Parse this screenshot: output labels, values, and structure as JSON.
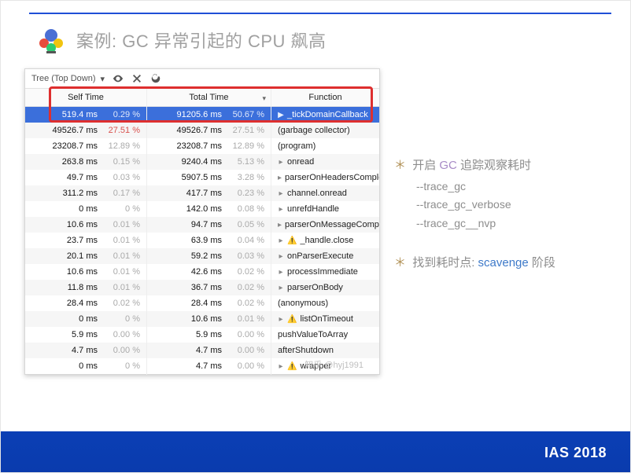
{
  "header": {
    "title": "案例: GC 异常引起的 CPU 飙高"
  },
  "panel": {
    "mode": "Tree (Top Down)",
    "columns": {
      "self": "Self Time",
      "total": "Total Time",
      "func": "Function"
    },
    "rows": [
      {
        "self_ms": "519.4 ms",
        "self_pct": "0.29 %",
        "total_ms": "91205.6 ms",
        "total_pct": "50.67 %",
        "func": "_tickDomainCallback",
        "twisty": "▶",
        "selected": true
      },
      {
        "self_ms": "49526.7 ms",
        "self_pct": "27.51 %",
        "self_pct_red": true,
        "total_ms": "49526.7 ms",
        "total_pct": "27.51 %",
        "func": "(garbage collector)"
      },
      {
        "self_ms": "23208.7 ms",
        "self_pct": "12.89 %",
        "total_ms": "23208.7 ms",
        "total_pct": "12.89 %",
        "func": "(program)"
      },
      {
        "self_ms": "263.8 ms",
        "self_pct": "0.15 %",
        "total_ms": "9240.4 ms",
        "total_pct": "5.13 %",
        "func": "onread",
        "twisty": "▸"
      },
      {
        "self_ms": "49.7 ms",
        "self_pct": "0.03 %",
        "total_ms": "5907.5 ms",
        "total_pct": "3.28 %",
        "func": "parserOnHeadersComplete",
        "twisty": "▸"
      },
      {
        "self_ms": "311.2 ms",
        "self_pct": "0.17 %",
        "total_ms": "417.7 ms",
        "total_pct": "0.23 %",
        "func": "channel.onread",
        "twisty": "▸"
      },
      {
        "self_ms": "0 ms",
        "self_pct": "0 %",
        "total_ms": "142.0 ms",
        "total_pct": "0.08 %",
        "func": "unrefdHandle",
        "twisty": "▸"
      },
      {
        "self_ms": "10.6 ms",
        "self_pct": "0.01 %",
        "total_ms": "94.7 ms",
        "total_pct": "0.05 %",
        "func": "parserOnMessageComplete",
        "twisty": "▸"
      },
      {
        "self_ms": "23.7 ms",
        "self_pct": "0.01 %",
        "total_ms": "63.9 ms",
        "total_pct": "0.04 %",
        "func": "_handle.close",
        "twisty": "▸",
        "warn": true
      },
      {
        "self_ms": "20.1 ms",
        "self_pct": "0.01 %",
        "total_ms": "59.2 ms",
        "total_pct": "0.03 %",
        "func": "onParserExecute",
        "twisty": "▸"
      },
      {
        "self_ms": "10.6 ms",
        "self_pct": "0.01 %",
        "total_ms": "42.6 ms",
        "total_pct": "0.02 %",
        "func": "processImmediate",
        "twisty": "▸"
      },
      {
        "self_ms": "11.8 ms",
        "self_pct": "0.01 %",
        "total_ms": "36.7 ms",
        "total_pct": "0.02 %",
        "func": "parserOnBody",
        "twisty": "▸"
      },
      {
        "self_ms": "28.4 ms",
        "self_pct": "0.02 %",
        "total_ms": "28.4 ms",
        "total_pct": "0.02 %",
        "func": "(anonymous)"
      },
      {
        "self_ms": "0 ms",
        "self_pct": "0 %",
        "total_ms": "10.6 ms",
        "total_pct": "0.01 %",
        "func": "listOnTimeout",
        "twisty": "▸",
        "warn": true
      },
      {
        "self_ms": "5.9 ms",
        "self_pct": "0.00 %",
        "total_ms": "5.9 ms",
        "total_pct": "0.00 %",
        "func": "pushValueToArray"
      },
      {
        "self_ms": "4.7 ms",
        "self_pct": "0.00 %",
        "total_ms": "4.7 ms",
        "total_pct": "0.00 %",
        "func": "afterShutdown"
      },
      {
        "self_ms": "0 ms",
        "self_pct": "0 %",
        "total_ms": "4.7 ms",
        "total_pct": "0.00 %",
        "func": "wrapper",
        "twisty": "▸",
        "warn": true
      }
    ],
    "watermark": "知乎 @hyj1991"
  },
  "notes": {
    "line1_prefix": "开启 ",
    "line1_gc": "GC",
    "line1_suffix": " 追踪观察耗时",
    "flag1": "--trace_gc",
    "flag2": "--trace_gc_verbose",
    "flag3": "--trace_gc__nvp",
    "line2_prefix": "找到耗时点: ",
    "line2_scav": "scavenge",
    "line2_suffix": " 阶段",
    "ast": "＊"
  },
  "footer": {
    "conf": "IAS 2018"
  }
}
